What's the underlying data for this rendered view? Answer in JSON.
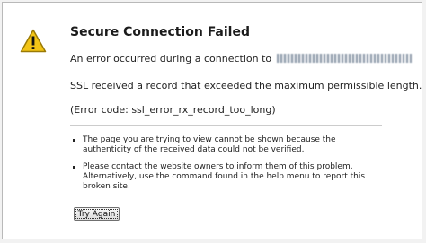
{
  "error_page": {
    "title": "Secure Connection Failed",
    "intro": "An error occurred during a connection to",
    "ssl_message": "SSL received a record that exceeded the maximum permissible length.",
    "error_code": "(Error code: ssl_error_rx_record_too_long)",
    "bullets": [
      "The page you are trying to view cannot be shown because the authenticity of the received data could not be verified.",
      "Please contact the website owners to inform them of this problem. Alternatively, use the command found in the help menu to report this broken site."
    ],
    "try_again_label": "Try Again",
    "icon": "warning-icon",
    "colors": {
      "warning_fill": "#f2c416",
      "warning_stroke": "#9a7a05",
      "background": "#ffffff",
      "page_border": "#b9b9b9"
    }
  }
}
